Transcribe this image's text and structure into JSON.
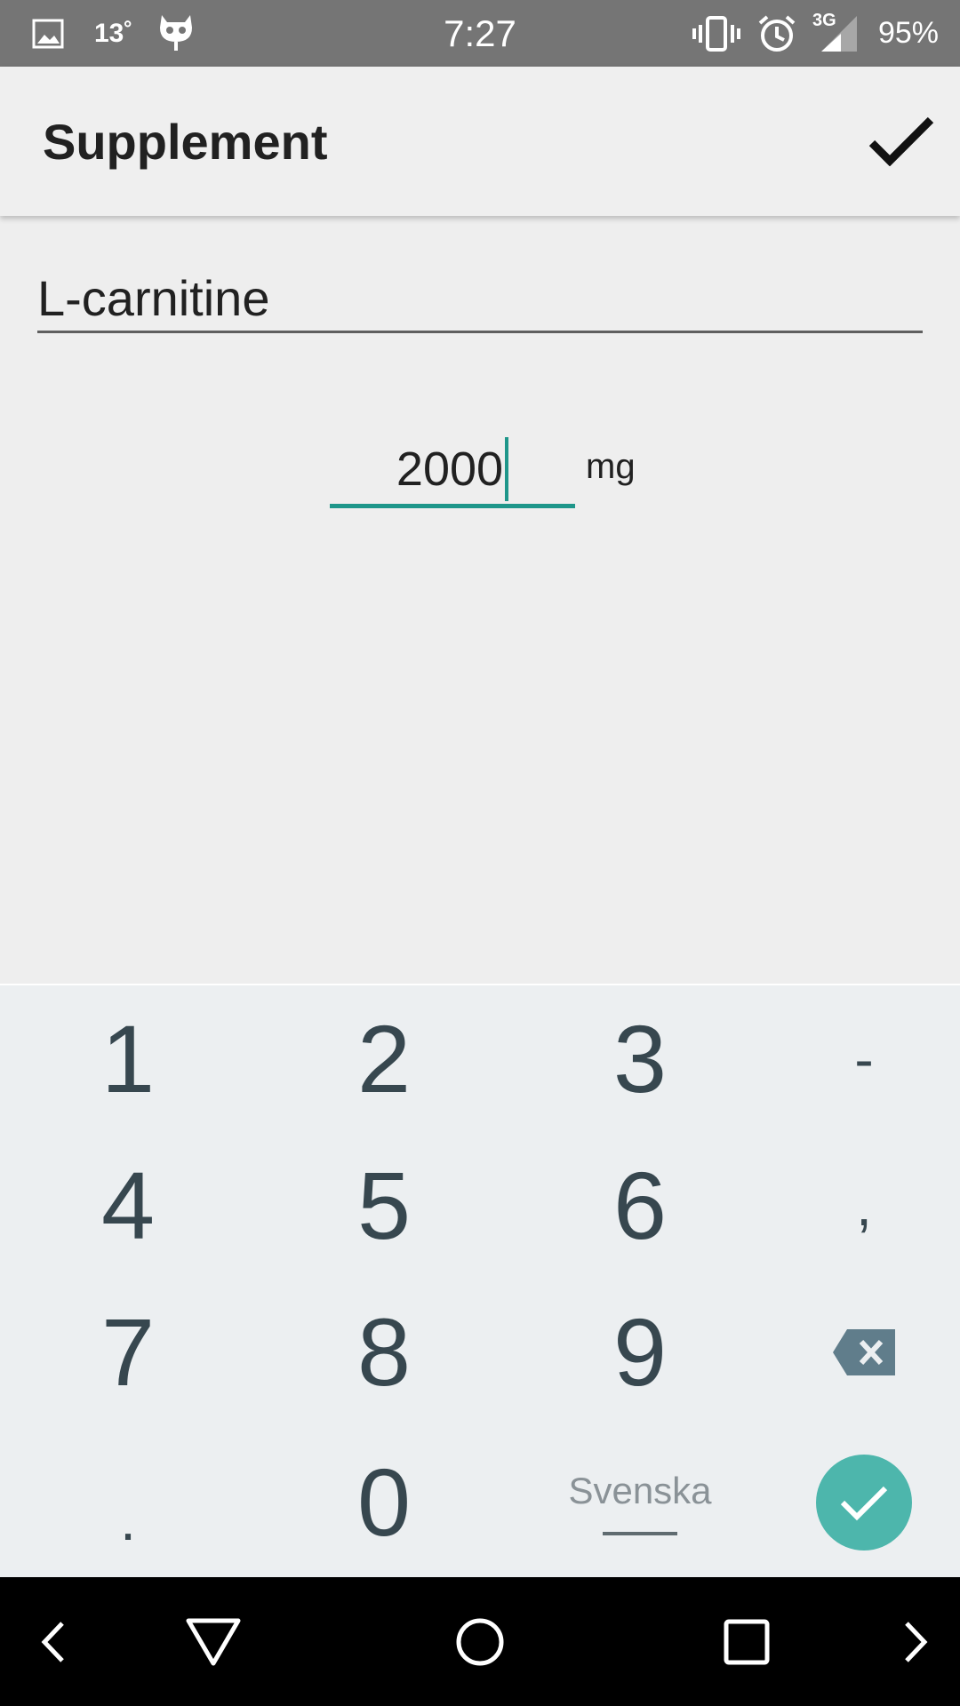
{
  "status_bar": {
    "temperature": "13˚",
    "time": "7:27",
    "network": "3G",
    "battery": "95%",
    "icons": [
      "gallery-icon",
      "cyanogen-mascot-icon",
      "vibrate-icon",
      "alarm-icon",
      "signal-icon"
    ]
  },
  "app_bar": {
    "title": "Supplement",
    "confirm_icon": "check-icon"
  },
  "form": {
    "name_value": "L-carnitine",
    "dose_value": "2000",
    "dose_unit": "mg"
  },
  "keyboard": {
    "rows": [
      [
        "1",
        "2",
        "3",
        "-"
      ],
      [
        "4",
        "5",
        "6",
        ","
      ],
      [
        "7",
        "8",
        "9",
        "backspace"
      ],
      [
        ".",
        "0",
        "Svenska",
        "enter"
      ]
    ],
    "language": "Svenska",
    "enter_color": "#4db6ac"
  },
  "nav_bar": {
    "icons": [
      "chevron-left-icon",
      "back-icon",
      "home-icon",
      "recents-icon",
      "chevron-right-icon"
    ]
  },
  "colors": {
    "status_bar": "#757575",
    "accent": "#1e968a",
    "keyboard_bg": "#eceff1",
    "key_text": "#37474f"
  }
}
